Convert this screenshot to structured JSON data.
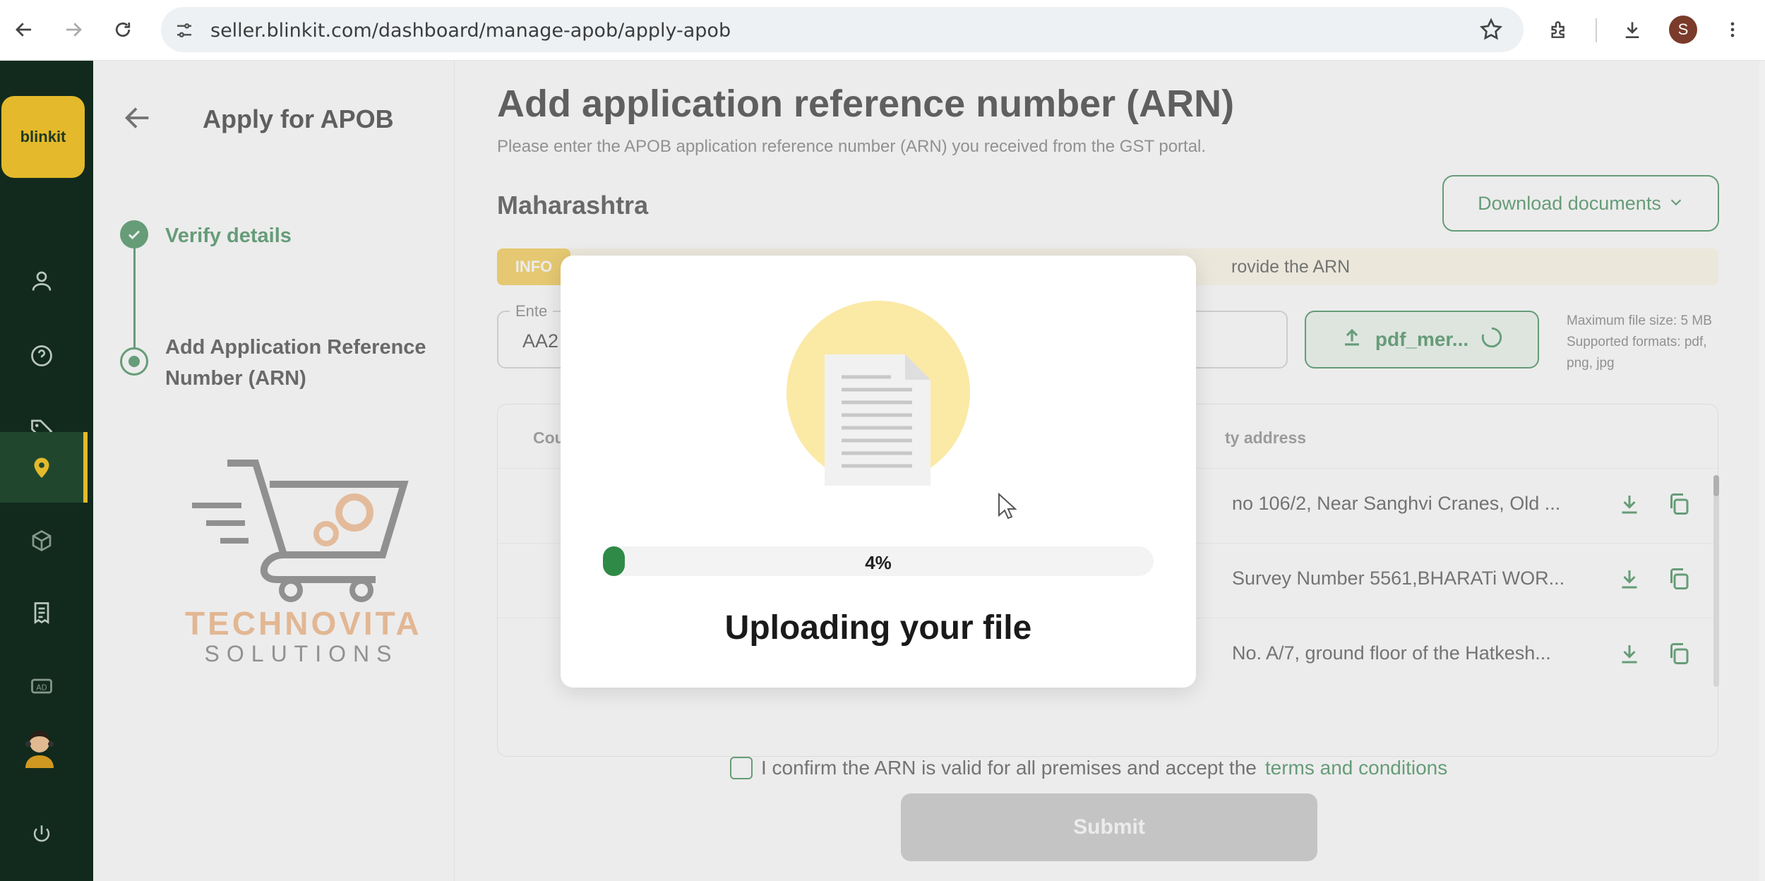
{
  "browser": {
    "url": "seller.blinkit.com/dashboard/manage-apob/apply-apob",
    "profile_initial": "S"
  },
  "rail": {
    "logo_text": "blinkit",
    "active_item": "location",
    "items": [
      "user-icon",
      "help-icon",
      "tag-icon",
      "location-icon",
      "box-icon",
      "invoice-icon",
      "ad-icon",
      "avatar",
      "power-icon"
    ]
  },
  "left_panel": {
    "title": "Apply for APOB",
    "steps": [
      {
        "label": "Verify details",
        "status": "completed"
      },
      {
        "label": "Add Application Reference Number (ARN)",
        "status": "current"
      }
    ],
    "watermark": {
      "line1": "TECHNOVITA",
      "line2": "SOLUTIONS"
    }
  },
  "main": {
    "title": "Add application reference number (ARN)",
    "subtitle": "Please enter the APOB application reference number (ARN) you received from the GST portal.",
    "state": "Maharashtra",
    "download_label": "Download documents",
    "info_badge": "INFO",
    "info_text": "rovide the ARN",
    "arn_label": "Ente",
    "arn_value": "AA2",
    "upload_label": "pdf_mer...",
    "upload_hint": "Maximum file size: 5 MB Supported formats: pdf, png, jpg",
    "table": {
      "header_left": "Cou",
      "header_right": "ty address",
      "rows": [
        {
          "address": "no 106/2, Near Sanghvi Cranes, Old ..."
        },
        {
          "address": "Survey Number 5561,BHARATi WOR..."
        },
        {
          "address": "No. A/7, ground floor of the Hatkesh..."
        }
      ]
    },
    "confirm_text": "I confirm the ARN is valid for all premises and accept the",
    "terms_link": "terms and conditions",
    "submit_label": "Submit"
  },
  "modal": {
    "progress_fraction": 0.04,
    "progress_text": "4%",
    "title": "Uploading your file"
  },
  "colors": {
    "brand_green": "#1e7a3d",
    "brand_yellow": "#f7c72b",
    "rail_bg": "#102a1c"
  }
}
